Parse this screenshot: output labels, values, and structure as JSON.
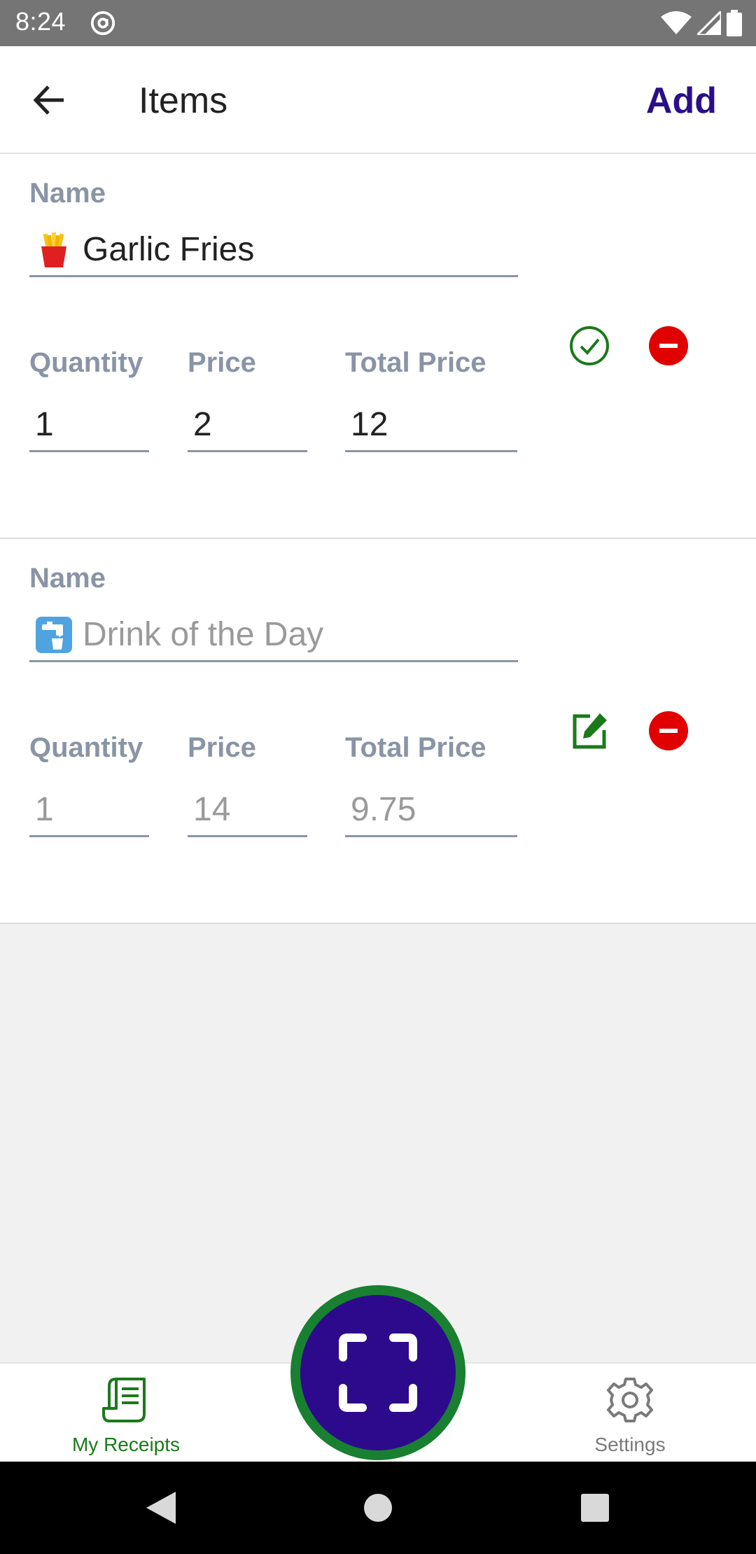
{
  "status_bar": {
    "time": "8:24"
  },
  "app_bar": {
    "title": "Items",
    "add_label": "Add"
  },
  "items": [
    {
      "name_label": "Name",
      "name_value": "Garlic Fries",
      "name_emoji": "french-fries-emoji",
      "quantity_label": "Quantity",
      "price_label": "Price",
      "total_label": "Total Price",
      "quantity": "1",
      "price": "2",
      "total": "12",
      "state": "editing",
      "action_icon": "check-circle-icon"
    },
    {
      "name_label": "Name",
      "name_value": "Drink of the Day",
      "name_emoji": "water-tap-emoji",
      "quantity_label": "Quantity",
      "price_label": "Price",
      "total_label": "Total Price",
      "quantity": "1",
      "price": "14",
      "total": "9.75",
      "state": "saved",
      "action_icon": "edit-icon"
    }
  ],
  "bottom_nav": {
    "receipts_label": "My Receipts",
    "settings_label": "Settings"
  },
  "colors": {
    "accent_purple": "#2d0a8c",
    "accent_green": "#1a7a1a",
    "delete_red": "#e00000",
    "label_gray": "#8a94a6"
  }
}
